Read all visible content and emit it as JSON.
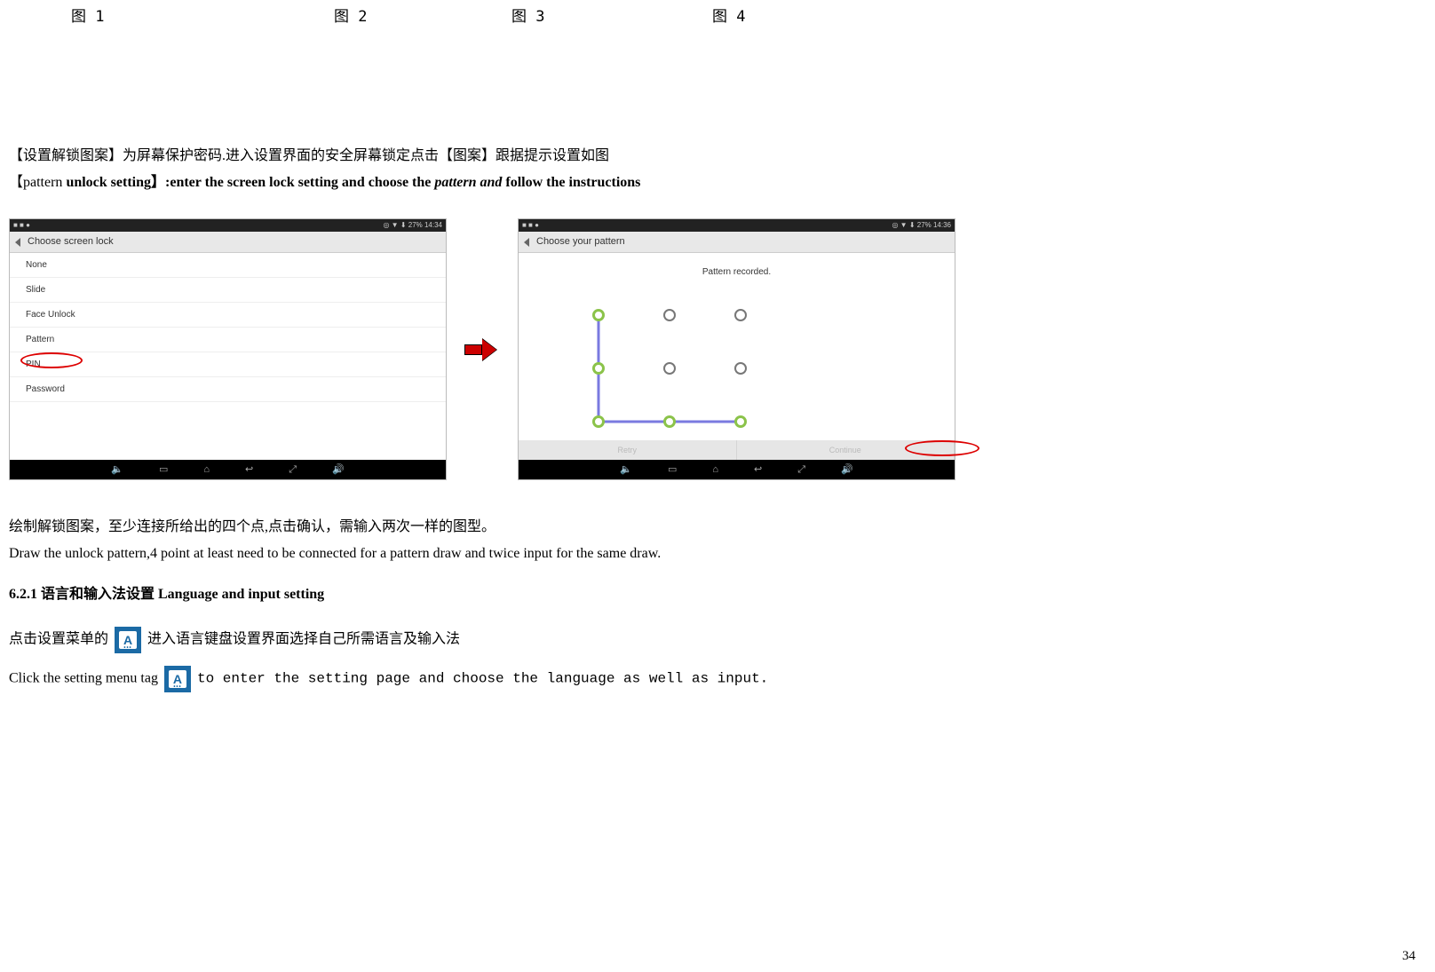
{
  "fig_labels": [
    "图 1",
    "图 2",
    "图 3",
    "图 4"
  ],
  "para_zh_lock": "【设置解锁图案】为屏幕保护密码.进入设置界面的安全屏幕锁定点击【图案】跟据提示设置如图",
  "para_en_lock_prefix": "【pattern ",
  "para_en_lock_bold1": "unlock setting】:enter the screen lock setting and choose the ",
  "para_en_lock_italic": "pattern and ",
  "para_en_lock_bold2": "follow the instructions",
  "shot1": {
    "status_left": "■ ■ ●",
    "status_right": "◎ ▼ ⬇ 27%  14:34",
    "title": "Choose screen lock",
    "options": [
      "None",
      "Slide",
      "Face Unlock",
      "Pattern",
      "PIN",
      "Password"
    ],
    "nav_icons": [
      "🔈",
      "▭",
      "⌂",
      "↩",
      "⤢",
      "🔊"
    ]
  },
  "arrow_label": "arrow",
  "shot2": {
    "status_left": "■ ■ ●",
    "status_right": "◎ ▼ ⬇ 27%  14:36",
    "title": "Choose your pattern",
    "message": "Pattern recorded.",
    "btn_left": "Retry",
    "btn_right": "Continue",
    "nav_icons": [
      "🔈",
      "▭",
      "⌂",
      "↩",
      "⤢",
      "🔊"
    ]
  },
  "para_draw_zh": "绘制解锁图案，至少连接所给出的四个点,点击确认，需输入两次一样的图型。",
  "para_draw_en": "Draw the unlock pattern,4 point at least need to be connected for a pattern draw and twice input for the same draw.",
  "section_title": "6.2.1 语言和输入法设置 Language and input setting",
  "para_lang_zh_pre": "点击设置菜单的",
  "para_lang_zh_post": "进入语言键盘设置界面选择自己所需语言及输入法",
  "para_lang_en_pre": "Click the setting menu tag ",
  "para_lang_en_post": "to enter the setting page and choose the language as well as input.",
  "icon_letter": "A",
  "page_number": "34"
}
